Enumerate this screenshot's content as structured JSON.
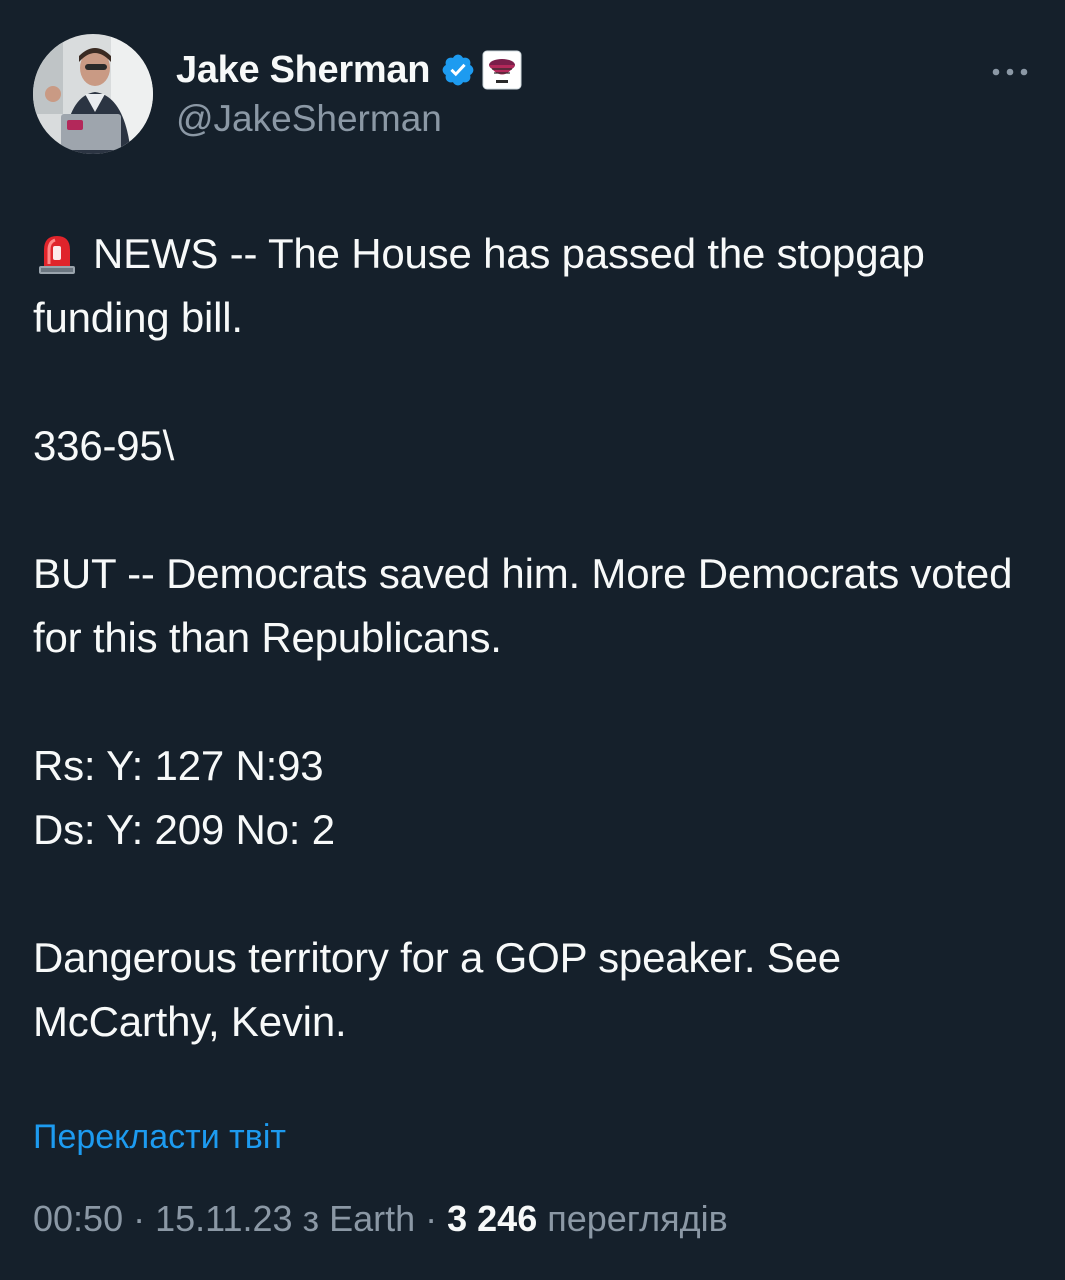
{
  "author": {
    "display_name": "Jake Sherman",
    "handle": "@JakeSherman",
    "verified_icon": "verified-badge-icon",
    "affiliate_icon": "punchbowl-affiliate-icon"
  },
  "tweet": {
    "siren_icon": "police-siren-emoji",
    "line1": "NEWS -- The House has passed the stopgap funding bill.",
    "line2": "336-95\\",
    "line3": "BUT -- Democrats saved him. More Democrats voted for this than Republicans.",
    "line4a": "Rs: Y: 127 N:93",
    "line4b": "Ds: Y: 209 No: 2",
    "line5": "Dangerous territory for a GOP speaker. See McCarthy, Kevin."
  },
  "translate_label": "Перекласти твіт",
  "meta": {
    "time": "00:50",
    "separator": " · ",
    "date": "15.11.23",
    "source": "з Earth",
    "views_count": "3 246",
    "views_label": "переглядів"
  },
  "colors": {
    "background": "#15202b",
    "text": "#f7f9f9",
    "secondary": "#8b98a5",
    "accent": "#1d9bf0"
  }
}
